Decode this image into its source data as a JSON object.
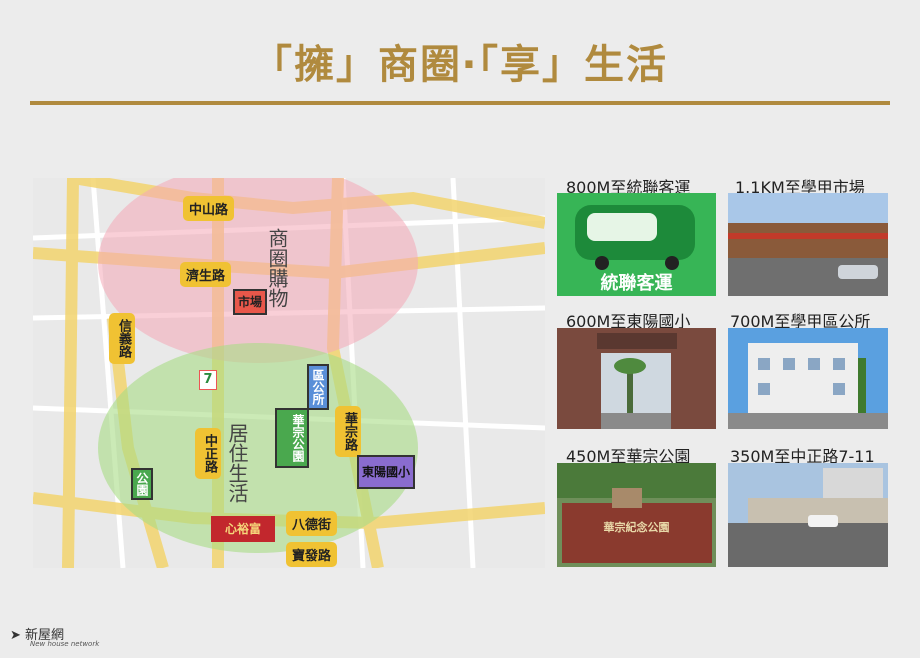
{
  "title": "「擁」商圈‧「享」生活",
  "map": {
    "zone_commerce": "商圈購物",
    "zone_living": "居住生活",
    "roads": {
      "zhongshan": "中山路",
      "jisheng": "濟生路",
      "xinyi": "信義路",
      "zhongzheng": "中正路",
      "huazong": "華宗路",
      "bade": "八德街",
      "baofa": "寶發路"
    },
    "poi": {
      "market": "市場",
      "district_office": "區公所",
      "huazong_park": "華宗公園",
      "park": "公園",
      "dongyang_school": "東陽國小",
      "xinshifu": "心裕富"
    },
    "store_logo": "7"
  },
  "nearby": [
    {
      "caption": "800M至統聯客運",
      "photo_text": "統聯客運"
    },
    {
      "caption": "1.1KM至學甲市場"
    },
    {
      "caption": "600M至東陽國小"
    },
    {
      "caption": "700M至學甲區公所"
    },
    {
      "caption": "450M至華宗公園",
      "photo_text": "華宗紀念公園"
    },
    {
      "caption": "350M至中正路7-11"
    }
  ],
  "footer": {
    "brand": "新屋網",
    "sub": "New house network"
  },
  "colors": {
    "gold": "#b08a3e",
    "road_yellow": "#f0c233"
  }
}
